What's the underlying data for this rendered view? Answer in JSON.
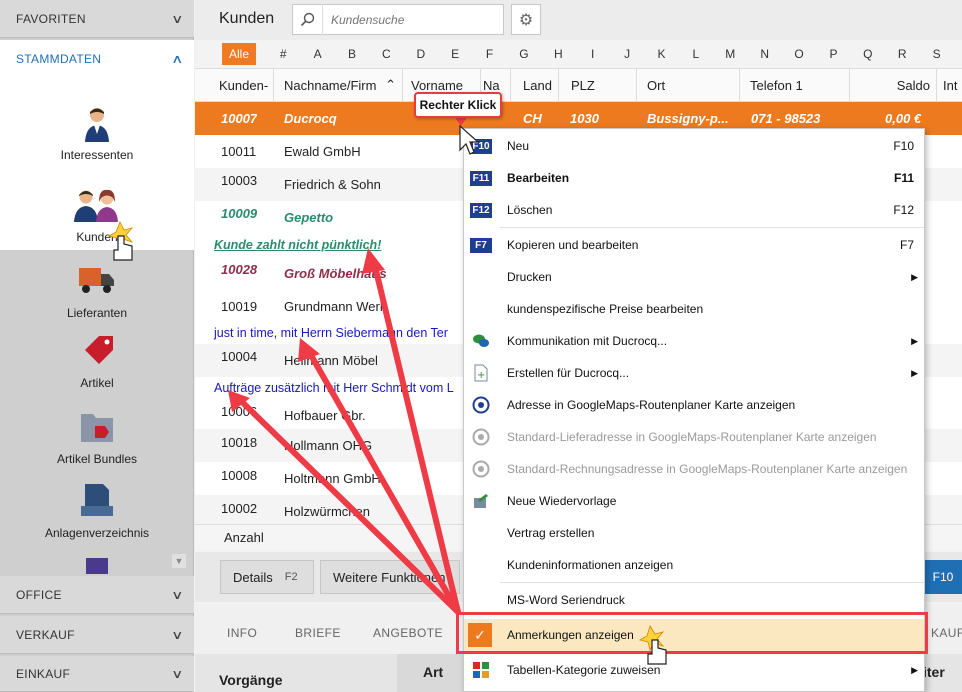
{
  "sidebar": {
    "favoriten": "FAVORITEN",
    "stammdaten": "STAMMDATEN",
    "items": [
      {
        "label": "Interessenten",
        "icon": "person-icon"
      },
      {
        "label": "Kunden",
        "icon": "customers-icon"
      },
      {
        "label": "Lieferanten",
        "icon": "truck-icon"
      },
      {
        "label": "Artikel",
        "icon": "tag-icon"
      },
      {
        "label": "Artikel Bundles",
        "icon": "folder-icon"
      },
      {
        "label": "Anlagenverzeichnis",
        "icon": "document-icon"
      }
    ],
    "office": "OFFICE",
    "verkauf": "VERKAUF",
    "einkauf": "EINKAUF"
  },
  "header": {
    "title": "Kunden",
    "search_placeholder": "Kundensuche"
  },
  "alphabet": {
    "all": "Alle",
    "letters": [
      "#",
      "A",
      "B",
      "C",
      "D",
      "E",
      "F",
      "G",
      "H",
      "I",
      "J",
      "K",
      "L",
      "M",
      "N",
      "O",
      "P",
      "Q",
      "R",
      "S"
    ]
  },
  "table": {
    "headers": [
      "Kunden-",
      "Nachname/Firm",
      "Vorname",
      "Na",
      "Land",
      "PLZ",
      "Ort",
      "Telefon 1",
      "Saldo",
      "Int"
    ],
    "selected": {
      "nr": "10007",
      "name": "Ducrocq",
      "land": "CH",
      "plz": "1030",
      "ort": "Bussigny-p...",
      "tel": "071 - 98523",
      "saldo": "0,00 €"
    },
    "rows": [
      {
        "nr": "10011",
        "name": "Ewald GmbH"
      },
      {
        "nr": "10003",
        "name": "Friedrich & Sohn"
      },
      {
        "nr": "10009",
        "name": "Gepetto"
      },
      {
        "nr": "10028",
        "name": "Groß Möbelhaus"
      },
      {
        "nr": "10019",
        "name": "Grundmann Werk"
      },
      {
        "nr": "10004",
        "name": "Heilmann Möbel"
      },
      {
        "nr": "10006",
        "name": "Hofbauer Gbr."
      },
      {
        "nr": "10018",
        "name": "Hollmann OHG"
      },
      {
        "nr": "10008",
        "name": "Holtmann GmbH"
      },
      {
        "nr": "10002",
        "name": "Holzwürmchen"
      }
    ],
    "notes": [
      "Kunde zahlt nicht pünktlich!",
      "just in time, mit Herrn Siebermann den Ter",
      "Aufträge zusätzlich mit Herr Schmidt vom L"
    ],
    "count_label": "Anzahl"
  },
  "buttons": {
    "details": "Details",
    "details_key": "F2",
    "weitere": "Weitere Funktionen",
    "f10": "F10"
  },
  "tabs": [
    "INFO",
    "BRIEFE",
    "ANGEBOTE",
    "KAUF"
  ],
  "bottom": {
    "vorgaenge": "Vorgänge",
    "art": "Art",
    "iter": "iter"
  },
  "callout": "Rechter Klick",
  "context_menu": [
    {
      "label": "Neu",
      "shortcut": "F10",
      "icon": "F10"
    },
    {
      "label": "Bearbeiten",
      "shortcut": "F11",
      "icon": "F11",
      "bold": true
    },
    {
      "label": "Löschen",
      "shortcut": "F12",
      "icon": "F12"
    },
    {
      "label": "Kopieren und bearbeiten",
      "shortcut": "F7",
      "icon": "F7"
    },
    {
      "label": "Drucken",
      "submenu": true
    },
    {
      "label": "kundenspezifische Preise bearbeiten"
    },
    {
      "label": "Kommunikation mit Ducrocq...",
      "submenu": true
    },
    {
      "label": "Erstellen für Ducrocq...",
      "submenu": true
    },
    {
      "label": "Adresse in GoogleMaps-Routenplaner Karte anzeigen"
    },
    {
      "label": "Standard-Lieferadresse in GoogleMaps-Routenplaner Karte anzeigen",
      "disabled": true
    },
    {
      "label": "Standard-Rechnungsadresse in GoogleMaps-Routenplaner Karte anzeigen",
      "disabled": true
    },
    {
      "label": "Neue Wiedervorlage"
    },
    {
      "label": "Vertrag erstellen"
    },
    {
      "label": "Kundeninformationen anzeigen"
    },
    {
      "label": "MS-Word Seriendruck"
    },
    {
      "label": "Anmerkungen anzeigen",
      "checked": true
    },
    {
      "label": "Tabellen-Kategorie zuweisen",
      "submenu": true
    }
  ],
  "colors": {
    "accent_orange": "#ee7a1f",
    "highlight_red": "#ef3b45",
    "link_blue": "#1f6fb5",
    "note_green": "#2a8c6a",
    "note_maroon": "#8c2f4a"
  }
}
